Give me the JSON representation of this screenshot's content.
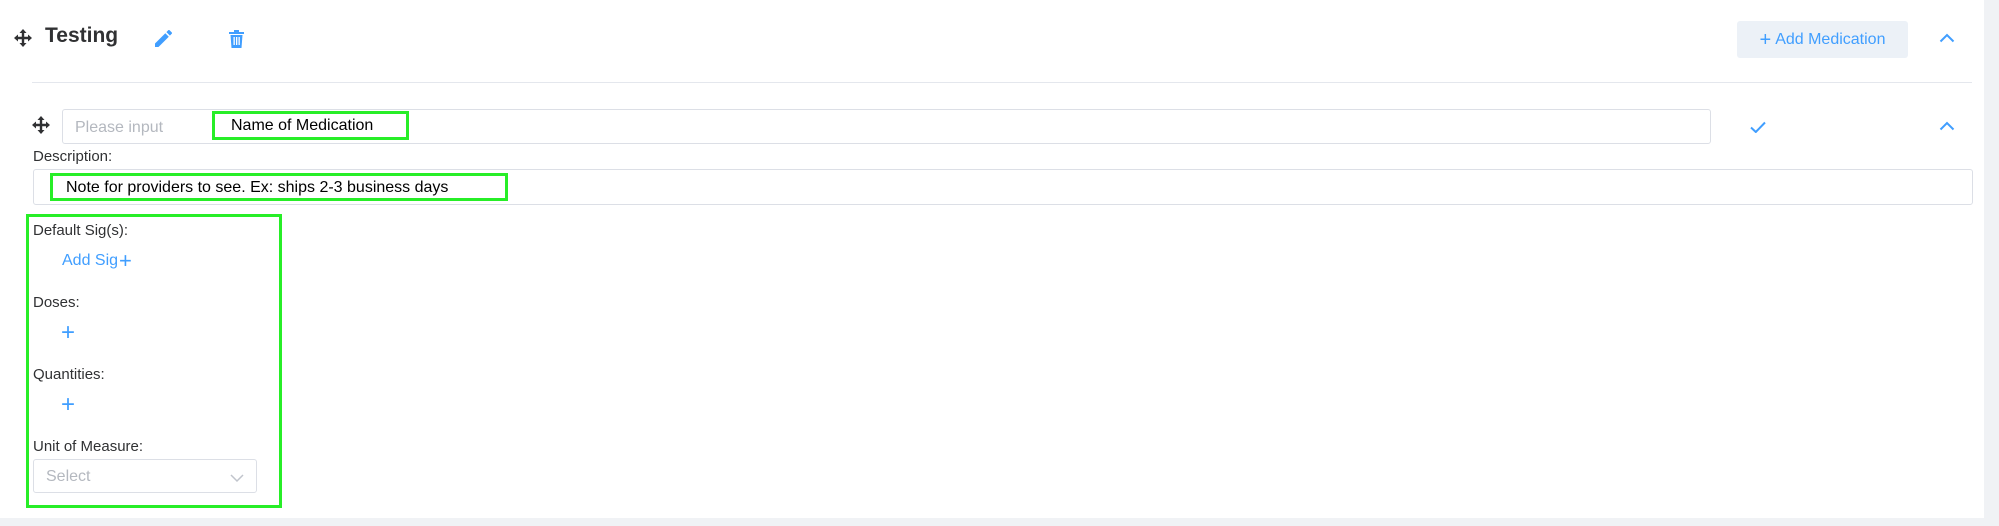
{
  "group": {
    "title": "Testing",
    "add_medication_label": "Add Medication",
    "icons": [
      "move-icon",
      "edit-icon",
      "trash-icon",
      "chevron-up-icon"
    ]
  },
  "medication": {
    "name_placeholder": "Please input",
    "name_hint": "Name of Medication",
    "description_label": "Description:",
    "description_hint": "Note for providers to see. Ex: ships 2-3 business days",
    "default_sigs_label": "Default Sig(s):",
    "add_sig_label": "Add Sig",
    "doses_label": "Doses:",
    "quantities_label": "Quantities:",
    "unit_label": "Unit of Measure:",
    "unit_placeholder": "Select",
    "icons": [
      "move-icon",
      "check-icon",
      "chevron-up-icon",
      "plus-icon",
      "chevron-down-icon"
    ]
  },
  "colors": {
    "accent": "#409eff",
    "highlight": "#27ee27",
    "button_bg": "#ecf1f7"
  }
}
